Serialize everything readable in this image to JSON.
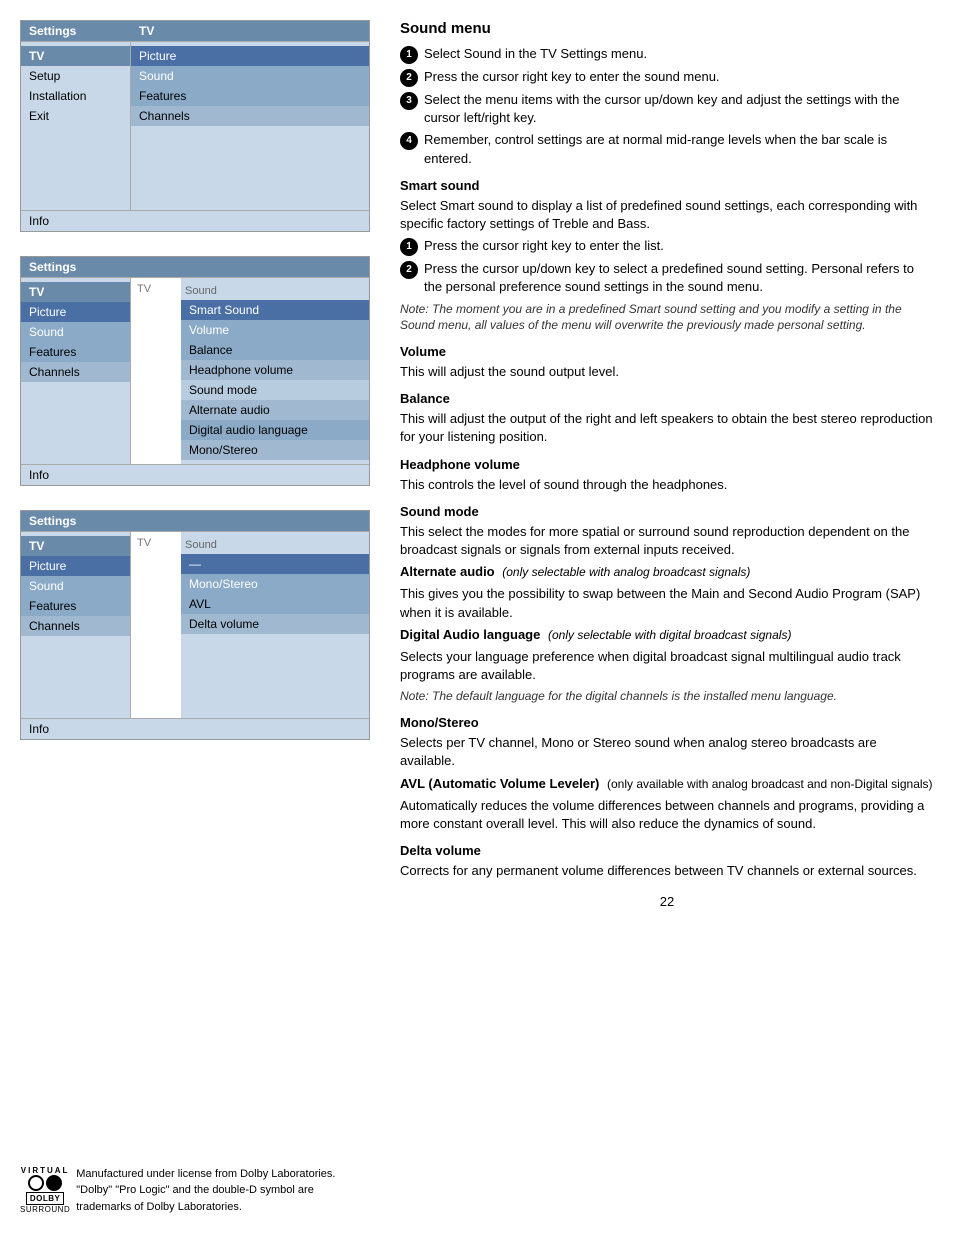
{
  "left": {
    "menu1": {
      "topbar": {
        "left": "Settings",
        "right": "TV"
      },
      "left_items": [
        {
          "label": "TV",
          "style": "header-row"
        },
        {
          "label": "Setup",
          "style": "menu-item"
        },
        {
          "label": "Installation",
          "style": "menu-item"
        },
        {
          "label": "Exit",
          "style": "menu-item"
        },
        {
          "label": "",
          "style": "empty-row"
        },
        {
          "label": "",
          "style": "empty-row"
        },
        {
          "label": "",
          "style": "empty-row"
        },
        {
          "label": "",
          "style": "empty-row"
        }
      ],
      "right_items": [
        {
          "label": "Picture",
          "style": "selected-blue"
        },
        {
          "label": "Sound",
          "style": "highlight"
        },
        {
          "label": "Features",
          "style": "dark-row"
        },
        {
          "label": "Channels",
          "style": "medium-row"
        },
        {
          "label": "",
          "style": "empty-row"
        },
        {
          "label": "",
          "style": "empty-row"
        },
        {
          "label": "",
          "style": "empty-row"
        },
        {
          "label": "",
          "style": "empty-row"
        }
      ],
      "info": "Info"
    },
    "menu2": {
      "topbar": {
        "left": "Settings",
        "right": ""
      },
      "tv_label": "TV",
      "sound_label": "Sound",
      "left_items": [
        {
          "label": "TV",
          "style": "header-row"
        },
        {
          "label": "Picture",
          "style": "selected-blue"
        },
        {
          "label": "Sound",
          "style": "highlight"
        },
        {
          "label": "Features",
          "style": "dark-row"
        },
        {
          "label": "Channels",
          "style": "medium-row"
        },
        {
          "label": "",
          "style": "empty-row"
        },
        {
          "label": "",
          "style": "empty-row"
        },
        {
          "label": "",
          "style": "empty-row"
        }
      ],
      "right_items": [
        {
          "label": "Smart Sound",
          "style": "selected-blue"
        },
        {
          "label": "Volume",
          "style": "highlight"
        },
        {
          "label": "Balance",
          "style": "dark-row"
        },
        {
          "label": "Headphone volume",
          "style": "medium-row"
        },
        {
          "label": "Sound mode",
          "style": "light-row"
        },
        {
          "label": "Alternate audio",
          "style": "medium-row"
        },
        {
          "label": "Digital audio language",
          "style": "dark-row"
        },
        {
          "label": "Mono/Stereo",
          "style": "medium-row"
        }
      ],
      "info": "Info"
    },
    "menu3": {
      "topbar": {
        "left": "Settings",
        "right": ""
      },
      "tv_label": "TV",
      "sound_label": "Sound",
      "left_items": [
        {
          "label": "TV",
          "style": "header-row"
        },
        {
          "label": "Picture",
          "style": "selected-blue"
        },
        {
          "label": "Sound",
          "style": "highlight"
        },
        {
          "label": "Features",
          "style": "dark-row"
        },
        {
          "label": "Channels",
          "style": "medium-row"
        },
        {
          "label": "",
          "style": "empty-row"
        },
        {
          "label": "",
          "style": "empty-row"
        },
        {
          "label": "",
          "style": "empty-row"
        }
      ],
      "right_items": [
        {
          "label": "—",
          "style": "selected-blue"
        },
        {
          "label": "Mono/Stereo",
          "style": "highlight"
        },
        {
          "label": "AVL",
          "style": "dark-row"
        },
        {
          "label": "Delta volume",
          "style": "medium-row"
        },
        {
          "label": "",
          "style": "empty-row"
        },
        {
          "label": "",
          "style": "empty-row"
        },
        {
          "label": "",
          "style": "empty-row"
        },
        {
          "label": "",
          "style": "empty-row"
        }
      ],
      "info": "Info"
    }
  },
  "right": {
    "title": "Sound menu",
    "steps": [
      "Select Sound in the TV Settings menu.",
      "Press the cursor right key to enter the sound menu.",
      "Select the menu items with the cursor up/down key and adjust the settings with the cursor left/right key.",
      "Remember, control settings are at normal mid-range levels when the bar scale is entered."
    ],
    "sections": [
      {
        "id": "smart-sound",
        "heading": "Smart sound",
        "body": "Select Smart sound to display a list of predefined sound settings, each corresponding with specific factory settings of Treble and Bass.",
        "substeps": [
          "Press the cursor right key to enter the list.",
          "Press the cursor up/down key to select a predefined sound setting. Personal refers to the personal preference sound settings in the sound menu."
        ],
        "note": "Note: The moment you are in a predefined Smart sound setting and you modify a setting in the Sound menu, all values of the menu will overwrite the previously made personal setting."
      },
      {
        "id": "volume",
        "heading": "Volume",
        "body": "This will adjust the sound output level."
      },
      {
        "id": "balance",
        "heading": "Balance",
        "body": "This will adjust the output of the right and left speakers to obtain the best stereo reproduction for your listening position."
      },
      {
        "id": "headphone-volume",
        "heading": "Headphone volume",
        "body": "This controls the level of sound through the headphones."
      },
      {
        "id": "sound-mode",
        "heading": "Sound mode",
        "body": "This select the modes for more spatial or surround sound reproduction dependent on the broadcast signals or signals from external inputs received."
      },
      {
        "id": "alternate-audio",
        "heading": "Alternate audio",
        "qualifier": "(only selectable with analog broadcast signals)",
        "body": "This gives you the possibility to swap between the Main and Second Audio Program (SAP) when it is available."
      },
      {
        "id": "digital-audio-language",
        "heading": "Digital Audio language",
        "qualifier": "(only selectable with digital broadcast signals)",
        "body": "Selects your language preference when digital broadcast signal multilingual audio track programs are available.",
        "note": "Note: The default language for the digital channels is the installed menu language."
      },
      {
        "id": "mono-stereo",
        "heading": "Mono/Stereo",
        "body": "Selects per TV channel, Mono or Stereo sound when analog stereo broadcasts are available."
      },
      {
        "id": "avl",
        "heading": "AVL (Automatic Volume Leveler)",
        "qualifier": "(only available with analog broadcast and non-Digital signals)",
        "body": "Automatically reduces the volume differences between channels and programs, providing a more constant overall level. This will also reduce the dynamics of sound."
      },
      {
        "id": "delta-volume",
        "heading": "Delta volume",
        "body": "Corrects for any permanent volume differences between TV channels or external sources."
      }
    ]
  },
  "footer": {
    "logos_text": "Manufactured under license from Dolby Laboratories. \"Dolby\" \"Pro Logic\" and the double-D symbol are trademarks of Dolby Laboratories.",
    "virtual_label": "VIRTUAL",
    "surround_label": "SURROUND",
    "dolby_label": "DOLBY",
    "page_number": "22"
  }
}
